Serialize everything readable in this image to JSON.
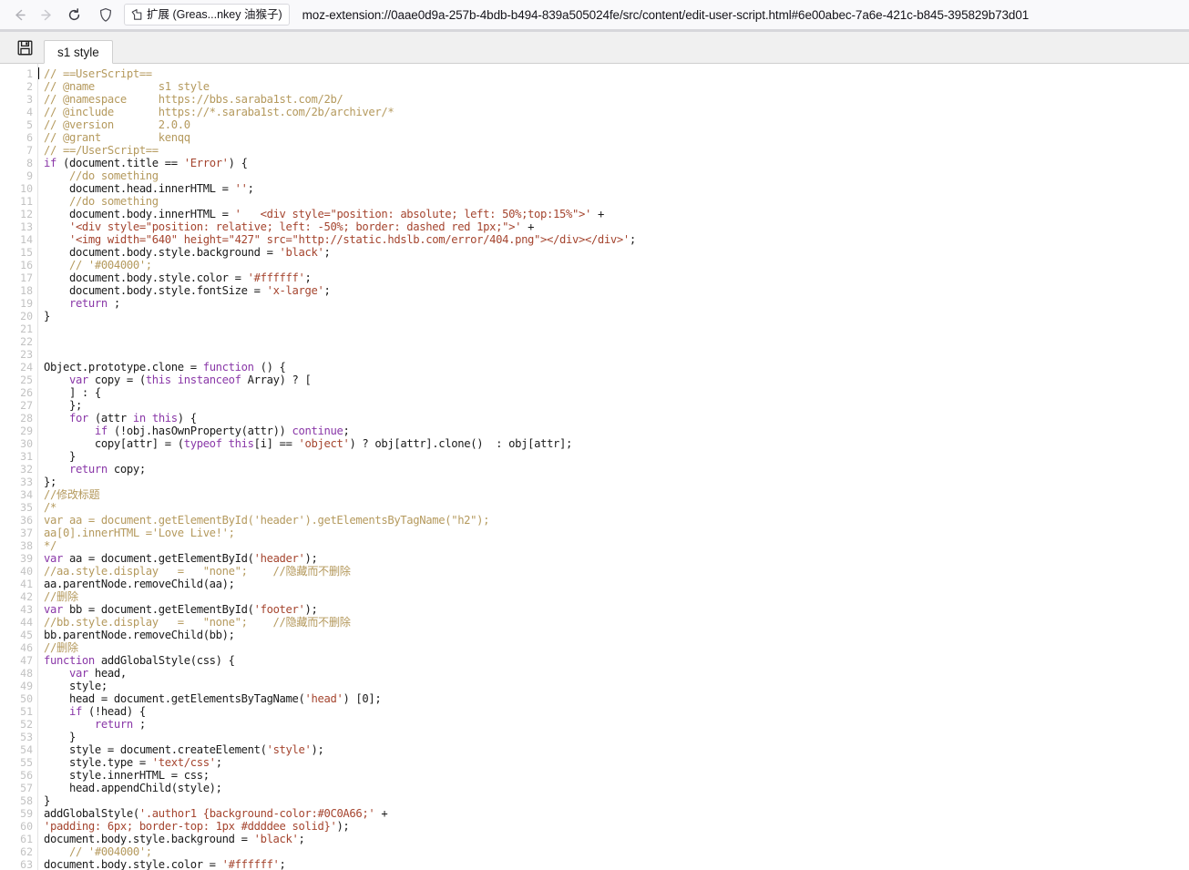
{
  "browser": {
    "back_label": "Back",
    "forward_label": "Forward",
    "reload_label": "Reload",
    "shield_label": "Tracking Protection",
    "extension_chip_label": "扩展 (Greas...nkey 油猴子)",
    "url": "moz-extension://0aae0d9a-257b-4bdb-b494-839a505024fe/src/content/edit-user-script.html#6e00abec-7a6e-421c-b845-395829b73d01"
  },
  "editor": {
    "save_label": "Save",
    "tab_label": "s1 style",
    "first_line_number": 1,
    "total_lines": 63,
    "colors": {
      "comment": "#b59a5e",
      "keyword": "#8a38a8",
      "string": "#a5452f",
      "plain": "#1a1a1a",
      "gutter": "#c2c2c2",
      "background": "#ffffff"
    },
    "lines": [
      [
        [
          "com",
          "// ==UserScript=="
        ]
      ],
      [
        [
          "com",
          "// @name          s1 style"
        ]
      ],
      [
        [
          "com",
          "// @namespace     https://bbs.saraba1st.com/2b/"
        ]
      ],
      [
        [
          "com",
          "// @include       https://*.saraba1st.com/2b/archiver/*"
        ]
      ],
      [
        [
          "com",
          "// @version       2.0.0"
        ]
      ],
      [
        [
          "com",
          "// @grant         kenqq"
        ]
      ],
      [
        [
          "com",
          "// ==/UserScript=="
        ]
      ],
      [
        [
          "key",
          "if"
        ],
        [
          "pln",
          " (document.title == "
        ],
        [
          "str",
          "'Error'"
        ],
        [
          "pln",
          ") {"
        ]
      ],
      [
        [
          "pln",
          "    "
        ],
        [
          "com",
          "//do something"
        ]
      ],
      [
        [
          "pln",
          "    document.head.innerHTML = "
        ],
        [
          "str",
          "''"
        ],
        [
          "pln",
          ";"
        ]
      ],
      [
        [
          "pln",
          "    "
        ],
        [
          "com",
          "//do something"
        ]
      ],
      [
        [
          "pln",
          "    document.body.innerHTML = "
        ],
        [
          "str",
          "'   <div style=\"position: absolute; left: 50%;top:15%\">'"
        ],
        [
          "pln",
          " +"
        ]
      ],
      [
        [
          "pln",
          "    "
        ],
        [
          "str",
          "'<div style=\"position: relative; left: -50%; border: dashed red 1px;\">'"
        ],
        [
          "pln",
          " +"
        ]
      ],
      [
        [
          "pln",
          "    "
        ],
        [
          "str",
          "'<img width=\"640\" height=\"427\" src=\"http://static.hdslb.com/error/404.png\"></div></div>'"
        ],
        [
          "pln",
          ";"
        ]
      ],
      [
        [
          "pln",
          "    document.body.style.background = "
        ],
        [
          "str",
          "'black'"
        ],
        [
          "pln",
          ";"
        ]
      ],
      [
        [
          "pln",
          "    "
        ],
        [
          "com",
          "// '#004000';"
        ]
      ],
      [
        [
          "pln",
          "    document.body.style.color = "
        ],
        [
          "str",
          "'#ffffff'"
        ],
        [
          "pln",
          ";"
        ]
      ],
      [
        [
          "pln",
          "    document.body.style.fontSize = "
        ],
        [
          "str",
          "'x-large'"
        ],
        [
          "pln",
          ";"
        ]
      ],
      [
        [
          "pln",
          "    "
        ],
        [
          "key",
          "return"
        ],
        [
          "pln",
          " ;"
        ]
      ],
      [
        [
          "pln",
          "}"
        ]
      ],
      [
        [
          "pln",
          ""
        ]
      ],
      [
        [
          "pln",
          ""
        ]
      ],
      [
        [
          "pln",
          ""
        ]
      ],
      [
        [
          "pln",
          "Object.prototype.clone = "
        ],
        [
          "key",
          "function"
        ],
        [
          "pln",
          " () {"
        ]
      ],
      [
        [
          "pln",
          "    "
        ],
        [
          "key",
          "var"
        ],
        [
          "pln",
          " copy = ("
        ],
        [
          "key",
          "this instanceof"
        ],
        [
          "pln",
          " Array) ? ["
        ]
      ],
      [
        [
          "pln",
          "    ] : {"
        ]
      ],
      [
        [
          "pln",
          "    };"
        ]
      ],
      [
        [
          "pln",
          "    "
        ],
        [
          "key",
          "for"
        ],
        [
          "pln",
          " (attr "
        ],
        [
          "key",
          "in"
        ],
        [
          "pln",
          " "
        ],
        [
          "key",
          "this"
        ],
        [
          "pln",
          ") {"
        ]
      ],
      [
        [
          "pln",
          "        "
        ],
        [
          "key",
          "if"
        ],
        [
          "pln",
          " (!obj.hasOwnProperty(attr)) "
        ],
        [
          "key",
          "continue"
        ],
        [
          "pln",
          ";"
        ]
      ],
      [
        [
          "pln",
          "        copy[attr] = ("
        ],
        [
          "key",
          "typeof"
        ],
        [
          "pln",
          " "
        ],
        [
          "key",
          "this"
        ],
        [
          "pln",
          "[i] == "
        ],
        [
          "str",
          "'object'"
        ],
        [
          "pln",
          ") ? obj[attr].clone()  : obj[attr];"
        ]
      ],
      [
        [
          "pln",
          "    }"
        ]
      ],
      [
        [
          "pln",
          "    "
        ],
        [
          "key",
          "return"
        ],
        [
          "pln",
          " copy;"
        ]
      ],
      [
        [
          "pln",
          "};"
        ]
      ],
      [
        [
          "com",
          "//修改标题"
        ]
      ],
      [
        [
          "com",
          "/*"
        ]
      ],
      [
        [
          "com",
          "var aa = document.getElementById('header').getElementsByTagName(\"h2\");"
        ]
      ],
      [
        [
          "com",
          "aa[0].innerHTML ='Love Live!';"
        ]
      ],
      [
        [
          "com",
          "*/"
        ]
      ],
      [
        [
          "key",
          "var"
        ],
        [
          "pln",
          " aa = document.getElementById("
        ],
        [
          "str",
          "'header'"
        ],
        [
          "pln",
          ");"
        ]
      ],
      [
        [
          "com",
          "//aa.style.display   =   \"none\";    //隐藏而不删除"
        ]
      ],
      [
        [
          "pln",
          "aa.parentNode.removeChild(aa);"
        ]
      ],
      [
        [
          "com",
          "//删除"
        ]
      ],
      [
        [
          "key",
          "var"
        ],
        [
          "pln",
          " bb = document.getElementById("
        ],
        [
          "str",
          "'footer'"
        ],
        [
          "pln",
          ");"
        ]
      ],
      [
        [
          "com",
          "//bb.style.display   =   \"none\";    //隐藏而不删除"
        ]
      ],
      [
        [
          "pln",
          "bb.parentNode.removeChild(bb);"
        ]
      ],
      [
        [
          "com",
          "//删除"
        ]
      ],
      [
        [
          "key",
          "function"
        ],
        [
          "pln",
          " addGlobalStyle(css) {"
        ]
      ],
      [
        [
          "pln",
          "    "
        ],
        [
          "key",
          "var"
        ],
        [
          "pln",
          " head,"
        ]
      ],
      [
        [
          "pln",
          "    style;"
        ]
      ],
      [
        [
          "pln",
          "    head = document.getElementsByTagName("
        ],
        [
          "str",
          "'head'"
        ],
        [
          "pln",
          ") [0];"
        ]
      ],
      [
        [
          "pln",
          "    "
        ],
        [
          "key",
          "if"
        ],
        [
          "pln",
          " (!head) {"
        ]
      ],
      [
        [
          "pln",
          "        "
        ],
        [
          "key",
          "return"
        ],
        [
          "pln",
          " ;"
        ]
      ],
      [
        [
          "pln",
          "    }"
        ]
      ],
      [
        [
          "pln",
          "    style = document.createElement("
        ],
        [
          "str",
          "'style'"
        ],
        [
          "pln",
          ");"
        ]
      ],
      [
        [
          "pln",
          "    style.type = "
        ],
        [
          "str",
          "'text/css'"
        ],
        [
          "pln",
          ";"
        ]
      ],
      [
        [
          "pln",
          "    style.innerHTML = css;"
        ]
      ],
      [
        [
          "pln",
          "    head.appendChild(style);"
        ]
      ],
      [
        [
          "pln",
          "}"
        ]
      ],
      [
        [
          "pln",
          "addGlobalStyle("
        ],
        [
          "str",
          "'.author1 {background-color:#0C0A66;'"
        ],
        [
          "pln",
          " +"
        ]
      ],
      [
        [
          "str",
          "'padding: 6px; border-top: 1px #ddddee solid}'"
        ],
        [
          "pln",
          ");"
        ]
      ],
      [
        [
          "pln",
          "document.body.style.background = "
        ],
        [
          "str",
          "'black'"
        ],
        [
          "pln",
          ";"
        ]
      ],
      [
        [
          "pln",
          "    "
        ],
        [
          "com",
          "// '#004000';"
        ]
      ],
      [
        [
          "pln",
          "document.body.style.color = "
        ],
        [
          "str",
          "'#ffffff'"
        ],
        [
          "pln",
          ";"
        ]
      ]
    ]
  }
}
